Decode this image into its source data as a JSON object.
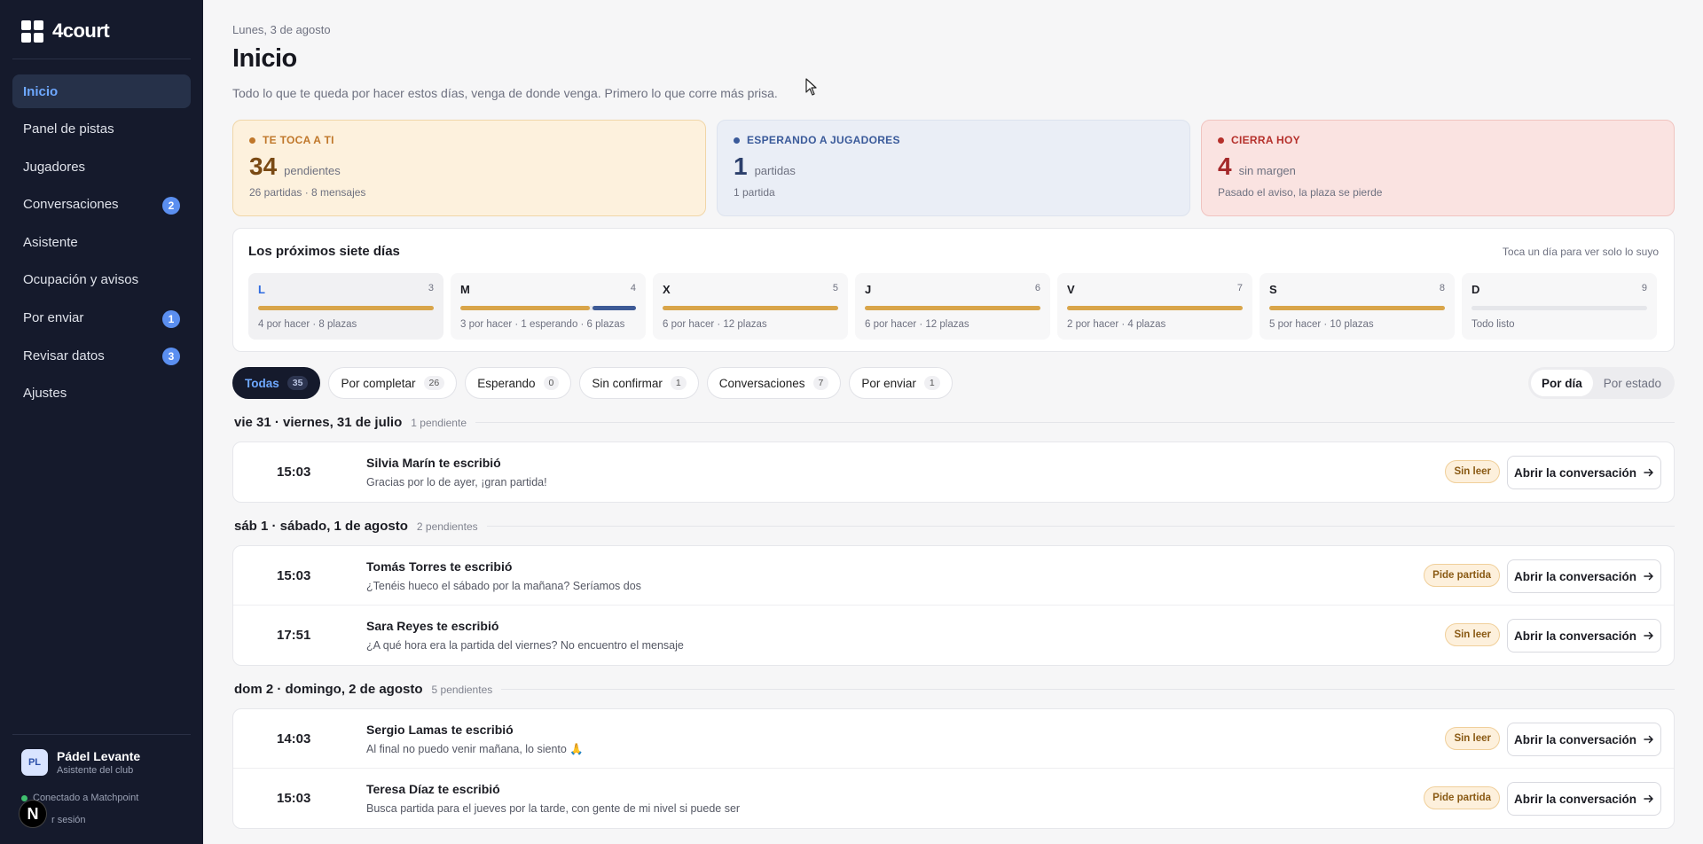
{
  "app": {
    "name": "4court"
  },
  "sidebar": {
    "items": [
      {
        "label": "Inicio",
        "badge": "",
        "active": true
      },
      {
        "label": "Panel de pistas",
        "badge": ""
      },
      {
        "label": "Jugadores",
        "badge": ""
      },
      {
        "label": "Conversaciones",
        "badge": "2"
      },
      {
        "label": "Asistente",
        "badge": ""
      },
      {
        "label": "Ocupación y avisos",
        "badge": ""
      },
      {
        "label": "Por enviar",
        "badge": "1"
      },
      {
        "label": "Revisar datos",
        "badge": "3"
      },
      {
        "label": "Ajustes",
        "badge": ""
      }
    ],
    "club": {
      "initials": "PL",
      "name": "Pádel Levante",
      "role": "Asistente del club"
    },
    "connection": "Conectado a Matchpoint",
    "logout": "r sesión",
    "n_badge": "N"
  },
  "header": {
    "date": "Lunes, 3 de agosto",
    "title": "Inicio",
    "subtitle": "Todo lo que te queda por hacer estos días, venga de donde venga. Primero lo que corre más prisa."
  },
  "summary": [
    {
      "label": "TE TOCA A TI",
      "number": "34",
      "unit": "pendientes",
      "detail": "26 partidas · 8 mensajes",
      "accent": "#c0772a",
      "numcolor": "#7a4a14",
      "bg": "#fdf1dd",
      "border": "#f0d6a8"
    },
    {
      "label": "ESPERANDO A JUGADORES",
      "number": "1",
      "unit": "partidas",
      "detail": "1 partida",
      "accent": "#3a5a9a",
      "numcolor": "#2c3f6b",
      "bg": "#eaeef6",
      "border": "#dde3ee"
    },
    {
      "label": "CIERRA HOY",
      "number": "4",
      "unit": "sin margen",
      "detail": "Pasado el aviso, la plaza se pierde",
      "accent": "#b5302b",
      "numcolor": "#a4282a",
      "bg": "#fae3e1",
      "border": "#f0c4c0"
    }
  ],
  "week": {
    "title": "Los próximos siete días",
    "hint": "Toca un día para ver solo lo suyo",
    "days": [
      {
        "letter": "L",
        "num": "3",
        "text": "4 por hacer · 8 plazas",
        "todo_fraction": 1,
        "waiting_fraction": 0,
        "selected": true
      },
      {
        "letter": "M",
        "num": "4",
        "text": "3 por hacer · 1 esperando · 6 plazas",
        "todo_fraction": 0.75,
        "waiting_fraction": 0.25
      },
      {
        "letter": "X",
        "num": "5",
        "text": "6 por hacer · 12 plazas",
        "todo_fraction": 1,
        "waiting_fraction": 0
      },
      {
        "letter": "J",
        "num": "6",
        "text": "6 por hacer · 12 plazas",
        "todo_fraction": 1,
        "waiting_fraction": 0
      },
      {
        "letter": "V",
        "num": "7",
        "text": "2 por hacer · 4 plazas",
        "todo_fraction": 1,
        "waiting_fraction": 0
      },
      {
        "letter": "S",
        "num": "8",
        "text": "5 por hacer · 10 plazas",
        "todo_fraction": 1,
        "waiting_fraction": 0
      },
      {
        "letter": "D",
        "num": "9",
        "text": "Todo listo",
        "todo_fraction": 0,
        "waiting_fraction": 0
      }
    ]
  },
  "colors": {
    "todo": "#d9a54a",
    "waiting": "#3d5a96"
  },
  "filters": [
    {
      "label": "Todas",
      "count": "35",
      "active": true
    },
    {
      "label": "Por completar",
      "count": "26"
    },
    {
      "label": "Esperando",
      "count": "0"
    },
    {
      "label": "Sin confirmar",
      "count": "1"
    },
    {
      "label": "Conversaciones",
      "count": "7"
    },
    {
      "label": "Por enviar",
      "count": "1"
    }
  ],
  "view_toggle": {
    "by_day": "Por día",
    "by_state": "Por estado"
  },
  "open_label": "Abrir la conversación",
  "groups": [
    {
      "title": "vie 31 · viernes, 31 de julio",
      "count": "1 pendiente",
      "rows": [
        {
          "time": "15:03",
          "title": "Silvia Marín te escribió",
          "msg": "Gracias por lo de ayer, ¡gran partida!",
          "tag": "Sin leer"
        }
      ]
    },
    {
      "title": "sáb 1 · sábado, 1 de agosto",
      "count": "2 pendientes",
      "rows": [
        {
          "time": "15:03",
          "title": "Tomás Torres te escribió",
          "msg": "¿Tenéis hueco el sábado por la mañana? Seríamos dos",
          "tag": "Pide partida"
        },
        {
          "time": "17:51",
          "title": "Sara Reyes te escribió",
          "msg": "¿A qué hora era la partida del viernes? No encuentro el mensaje",
          "tag": "Sin leer"
        }
      ]
    },
    {
      "title": "dom 2 · domingo, 2 de agosto",
      "count": "5 pendientes",
      "rows": [
        {
          "time": "14:03",
          "title": "Sergio Lamas te escribió",
          "msg": "Al final no puedo venir mañana, lo siento 🙏",
          "tag": "Sin leer"
        },
        {
          "time": "15:03",
          "title": "Teresa Díaz te escribió",
          "msg": "Busca partida para el jueves por la tarde, con gente de mi nivel si puede ser",
          "tag": "Pide partida"
        }
      ]
    }
  ]
}
